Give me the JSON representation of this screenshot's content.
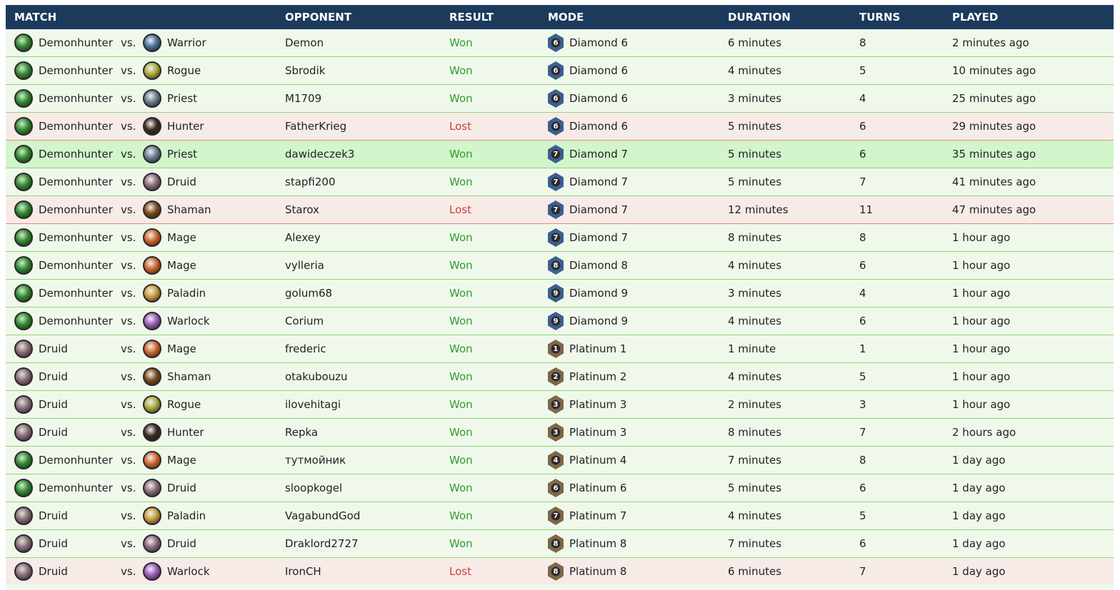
{
  "headers": {
    "match": "MATCH",
    "opponent": "OPPONENT",
    "result": "RESULT",
    "mode": "MODE",
    "duration": "DURATION",
    "turns": "TURNS",
    "played": "PLAYED"
  },
  "vs_label": "vs.",
  "class_colors": {
    "Demonhunter": "#2f8a2f",
    "Warrior": "#4b6f9c",
    "Rogue": "#a8a83c",
    "Priest": "#6a7a90",
    "Hunter": "#3a2a20",
    "Druid": "#8a6a7a",
    "Shaman": "#7a4a1a",
    "Mage": "#d0642a",
    "Paladin": "#c89a3a",
    "Warlock": "#9a5ab8"
  },
  "rank_colors": {
    "Diamond": "#3d5f8f",
    "Platinum": "#7d6848"
  },
  "rows": [
    {
      "player": "Demonhunter",
      "opp_class": "Warrior",
      "opponent": "Demon",
      "result": "Won",
      "mode": "Diamond 6",
      "rank_num": "6",
      "rank_type": "Diamond",
      "duration": "6 minutes",
      "turns": "8",
      "played": "2 minutes ago",
      "highlight": false
    },
    {
      "player": "Demonhunter",
      "opp_class": "Rogue",
      "opponent": "Sbrodik",
      "result": "Won",
      "mode": "Diamond 6",
      "rank_num": "6",
      "rank_type": "Diamond",
      "duration": "4 minutes",
      "turns": "5",
      "played": "10 minutes ago",
      "highlight": false
    },
    {
      "player": "Demonhunter",
      "opp_class": "Priest",
      "opponent": "M1709",
      "result": "Won",
      "mode": "Diamond 6",
      "rank_num": "6",
      "rank_type": "Diamond",
      "duration": "3 minutes",
      "turns": "4",
      "played": "25 minutes ago",
      "highlight": false
    },
    {
      "player": "Demonhunter",
      "opp_class": "Hunter",
      "opponent": "FatherKrieg",
      "result": "Lost",
      "mode": "Diamond 6",
      "rank_num": "6",
      "rank_type": "Diamond",
      "duration": "5 minutes",
      "turns": "6",
      "played": "29 minutes ago",
      "highlight": false
    },
    {
      "player": "Demonhunter",
      "opp_class": "Priest",
      "opponent": "dawideczek3",
      "result": "Won",
      "mode": "Diamond 7",
      "rank_num": "7",
      "rank_type": "Diamond",
      "duration": "5 minutes",
      "turns": "6",
      "played": "35 minutes ago",
      "highlight": true
    },
    {
      "player": "Demonhunter",
      "opp_class": "Druid",
      "opponent": "stapfi200",
      "result": "Won",
      "mode": "Diamond 7",
      "rank_num": "7",
      "rank_type": "Diamond",
      "duration": "5 minutes",
      "turns": "7",
      "played": "41 minutes ago",
      "highlight": false
    },
    {
      "player": "Demonhunter",
      "opp_class": "Shaman",
      "opponent": "Starox",
      "result": "Lost",
      "mode": "Diamond 7",
      "rank_num": "7",
      "rank_type": "Diamond",
      "duration": "12 minutes",
      "turns": "11",
      "played": "47 minutes ago",
      "highlight": false
    },
    {
      "player": "Demonhunter",
      "opp_class": "Mage",
      "opponent": "Alexey",
      "result": "Won",
      "mode": "Diamond 7",
      "rank_num": "7",
      "rank_type": "Diamond",
      "duration": "8 minutes",
      "turns": "8",
      "played": "1 hour ago",
      "highlight": false
    },
    {
      "player": "Demonhunter",
      "opp_class": "Mage",
      "opponent": "vylleria",
      "result": "Won",
      "mode": "Diamond 8",
      "rank_num": "8",
      "rank_type": "Diamond",
      "duration": "4 minutes",
      "turns": "6",
      "played": "1 hour ago",
      "highlight": false
    },
    {
      "player": "Demonhunter",
      "opp_class": "Paladin",
      "opponent": "golum68",
      "result": "Won",
      "mode": "Diamond 9",
      "rank_num": "9",
      "rank_type": "Diamond",
      "duration": "3 minutes",
      "turns": "4",
      "played": "1 hour ago",
      "highlight": false
    },
    {
      "player": "Demonhunter",
      "opp_class": "Warlock",
      "opponent": "Corium",
      "result": "Won",
      "mode": "Diamond 9",
      "rank_num": "9",
      "rank_type": "Diamond",
      "duration": "4 minutes",
      "turns": "6",
      "played": "1 hour ago",
      "highlight": false
    },
    {
      "player": "Druid",
      "opp_class": "Mage",
      "opponent": "frederic",
      "result": "Won",
      "mode": "Platinum 1",
      "rank_num": "1",
      "rank_type": "Platinum",
      "duration": "1 minute",
      "turns": "1",
      "played": "1 hour ago",
      "highlight": false
    },
    {
      "player": "Druid",
      "opp_class": "Shaman",
      "opponent": "otakubouzu",
      "result": "Won",
      "mode": "Platinum 2",
      "rank_num": "2",
      "rank_type": "Platinum",
      "duration": "4 minutes",
      "turns": "5",
      "played": "1 hour ago",
      "highlight": false
    },
    {
      "player": "Druid",
      "opp_class": "Rogue",
      "opponent": "ilovehitagi",
      "result": "Won",
      "mode": "Platinum 3",
      "rank_num": "3",
      "rank_type": "Platinum",
      "duration": "2 minutes",
      "turns": "3",
      "played": "1 hour ago",
      "highlight": false
    },
    {
      "player": "Druid",
      "opp_class": "Hunter",
      "opponent": "Repka",
      "result": "Won",
      "mode": "Platinum 3",
      "rank_num": "3",
      "rank_type": "Platinum",
      "duration": "8 minutes",
      "turns": "7",
      "played": "2 hours ago",
      "highlight": false
    },
    {
      "player": "Demonhunter",
      "opp_class": "Mage",
      "opponent": "тутмойник",
      "result": "Won",
      "mode": "Platinum 4",
      "rank_num": "4",
      "rank_type": "Platinum",
      "duration": "7 minutes",
      "turns": "8",
      "played": "1 day ago",
      "highlight": false
    },
    {
      "player": "Demonhunter",
      "opp_class": "Druid",
      "opponent": "sloopkogel",
      "result": "Won",
      "mode": "Platinum 6",
      "rank_num": "6",
      "rank_type": "Platinum",
      "duration": "5 minutes",
      "turns": "6",
      "played": "1 day ago",
      "highlight": false
    },
    {
      "player": "Druid",
      "opp_class": "Paladin",
      "opponent": "VagabundGod",
      "result": "Won",
      "mode": "Platinum 7",
      "rank_num": "7",
      "rank_type": "Platinum",
      "duration": "4 minutes",
      "turns": "5",
      "played": "1 day ago",
      "highlight": false
    },
    {
      "player": "Druid",
      "opp_class": "Druid",
      "opponent": "Draklord2727",
      "result": "Won",
      "mode": "Platinum 8",
      "rank_num": "8",
      "rank_type": "Platinum",
      "duration": "7 minutes",
      "turns": "6",
      "played": "1 day ago",
      "highlight": false
    },
    {
      "player": "Druid",
      "opp_class": "Warlock",
      "opponent": "IronCH",
      "result": "Lost",
      "mode": "Platinum 8",
      "rank_num": "8",
      "rank_type": "Platinum",
      "duration": "6 minutes",
      "turns": "7",
      "played": "1 day ago",
      "highlight": false
    }
  ]
}
